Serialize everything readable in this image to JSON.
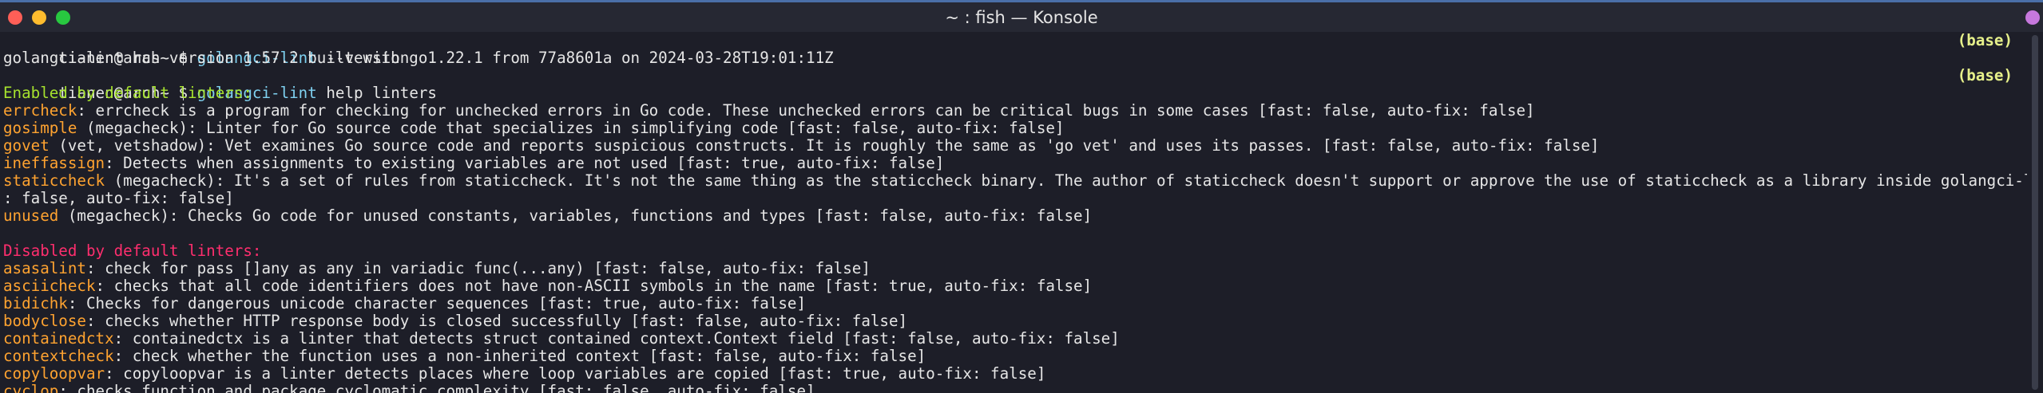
{
  "window": {
    "title": "~ : fish — Konsole",
    "accent": "#4a6fa8"
  },
  "terminal": {
    "prompt": "tianen@arch~ $",
    "badge": "(base)",
    "cmd1": {
      "bin": "golangci-lint",
      "args": "--version"
    },
    "version_output": "golangci-lint has version 1.57.2 built with go1.22.1 from 77a8601a on 2024-03-28T19:01:11Z",
    "cmd2": {
      "bin": "golangci-lint",
      "args": "help linters"
    },
    "enabled_header": "Enabled by default linters:",
    "enabled": [
      {
        "name": "errcheck",
        "desc": ": errcheck is a program for checking for unchecked errors in Go code. These unchecked errors can be critical bugs in some cases [fast: false, auto-fix: false]"
      },
      {
        "name": "gosimple",
        "desc": " (megacheck): Linter for Go source code that specializes in simplifying code [fast: false, auto-fix: false]"
      },
      {
        "name": "govet",
        "desc": " (vet, vetshadow): Vet examines Go source code and reports suspicious constructs. It is roughly the same as 'go vet' and uses its passes. [fast: false, auto-fix: false]"
      },
      {
        "name": "ineffassign",
        "desc": ": Detects when assignments to existing variables are not used [fast: true, auto-fix: false]"
      },
      {
        "name": "staticcheck",
        "desc": " (megacheck): It's a set of rules from staticcheck. It's not the same thing as the staticcheck binary. The author of staticcheck doesn't support or approve the use of staticcheck as a library inside golangci-lint. [fast"
      },
      {
        "name": "",
        "desc": ": false, auto-fix: false]"
      },
      {
        "name": "unused",
        "desc": " (megacheck): Checks Go code for unused constants, variables, functions and types [fast: false, auto-fix: false]"
      }
    ],
    "disabled_header": "Disabled by default linters:",
    "disabled": [
      {
        "name": "asasalint",
        "desc": ": check for pass []any as any in variadic func(...any) [fast: false, auto-fix: false]"
      },
      {
        "name": "asciicheck",
        "desc": ": checks that all code identifiers does not have non-ASCII symbols in the name [fast: true, auto-fix: false]"
      },
      {
        "name": "bidichk",
        "desc": ": Checks for dangerous unicode character sequences [fast: true, auto-fix: false]"
      },
      {
        "name": "bodyclose",
        "desc": ": checks whether HTTP response body is closed successfully [fast: false, auto-fix: false]"
      },
      {
        "name": "containedctx",
        "desc": ": containedctx is a linter that detects struct contained context.Context field [fast: false, auto-fix: false]"
      },
      {
        "name": "contextcheck",
        "desc": ": check whether the function uses a non-inherited context [fast: false, auto-fix: false]"
      },
      {
        "name": "copyloopvar",
        "desc": ": copyloopvar is a linter detects places where loop variables are copied [fast: true, auto-fix: false]"
      },
      {
        "name": "cyclop",
        "desc": ": checks function and package cyclomatic complexity [fast: false, auto-fix: false]"
      }
    ]
  }
}
